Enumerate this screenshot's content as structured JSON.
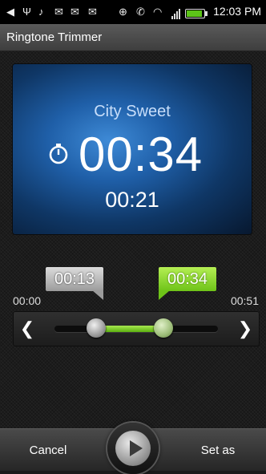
{
  "status_bar": {
    "time": "12:03 PM",
    "icons": [
      "back-icon",
      "usb-icon",
      "sound-icon",
      "mail-icon",
      "mail-icon",
      "gmail-icon",
      "gps-icon",
      "no-call-icon",
      "wifi-icon",
      "signal-icon",
      "battery-icon"
    ]
  },
  "app": {
    "title": "Ringtone Trimmer"
  },
  "player": {
    "song_title": "City Sweet",
    "end_time": "00:34",
    "duration": "00:21"
  },
  "trimmer": {
    "start_label": "00:13",
    "end_label": "00:34",
    "range_start": "00:00",
    "range_end": "00:51",
    "start_fraction": 0.255,
    "end_fraction": 0.667,
    "accent_color": "#7fd32a"
  },
  "bottom_bar": {
    "cancel_label": "Cancel",
    "set_as_label": "Set as"
  }
}
